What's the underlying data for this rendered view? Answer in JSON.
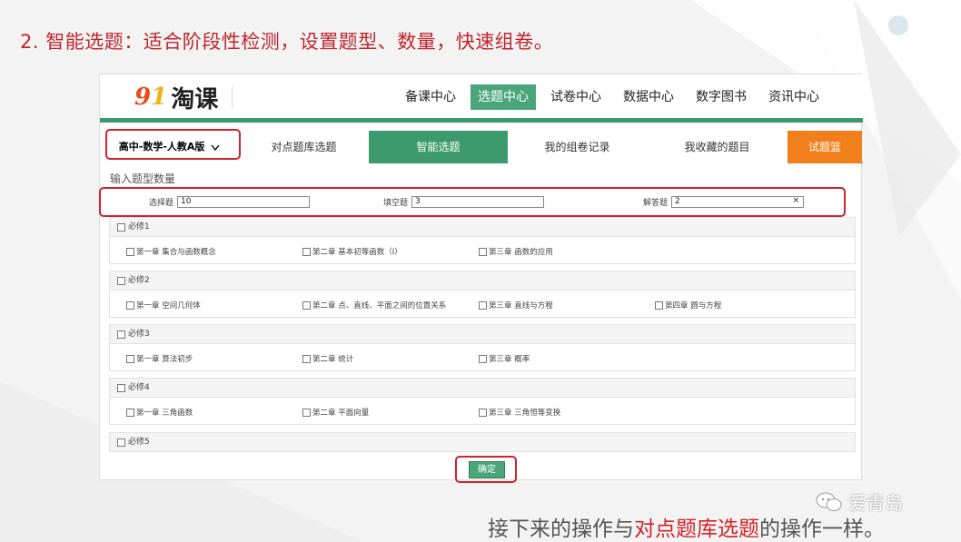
{
  "slide": {
    "title": "2.  智能选题：适合阶段性检测，设置题型、数量，快速组卷。",
    "caption_pre": "接下来的操作与",
    "caption_highlight": "对点题库选题",
    "caption_post": "的操作一样。",
    "watermark": "爱青岛"
  },
  "logo": {
    "nine": "9",
    "one": "1",
    "text": "淘课"
  },
  "mainnav": [
    "备课中心",
    "选题中心",
    "试卷中心",
    "数据中心",
    "数字图书",
    "资讯中心"
  ],
  "tabs": {
    "subject": "高中-数学-人教A版",
    "point": "对点题库选题",
    "smart": "智能选题",
    "records": "我的组卷记录",
    "favorites": "我收藏的题目",
    "basket": "试题篮"
  },
  "section_title": "输入题型数量",
  "counts": {
    "choice_label": "选择题",
    "choice_value": "10",
    "fill_label": "填空题",
    "fill_value": "3",
    "answer_label": "解答题",
    "answer_value": "2",
    "clear": "×"
  },
  "modules": [
    {
      "name": "必修1",
      "chapters": [
        "第一章 集合与函数概念",
        "第二章 基本初等函数（Ⅰ）",
        "第三章 函数的应用"
      ]
    },
    {
      "name": "必修2",
      "chapters": [
        "第一章 空间几何体",
        "第二章 点、直线、平面之间的位置关系",
        "第三章 直线与方程",
        "第四章 圆与方程"
      ]
    },
    {
      "name": "必修3",
      "chapters": [
        "第一章 算法初步",
        "第二章 统计",
        "第三章 概率"
      ]
    },
    {
      "name": "必修4",
      "chapters": [
        "第一章 三角函数",
        "第二章 平面向量",
        "第三章 三角恒等变换"
      ]
    },
    {
      "name": "必修5",
      "chapters": []
    }
  ],
  "confirm": "确定",
  "colors": {
    "accent": "#3c9a6c",
    "highlight": "#d0232a",
    "basket": "#f07f1c"
  }
}
